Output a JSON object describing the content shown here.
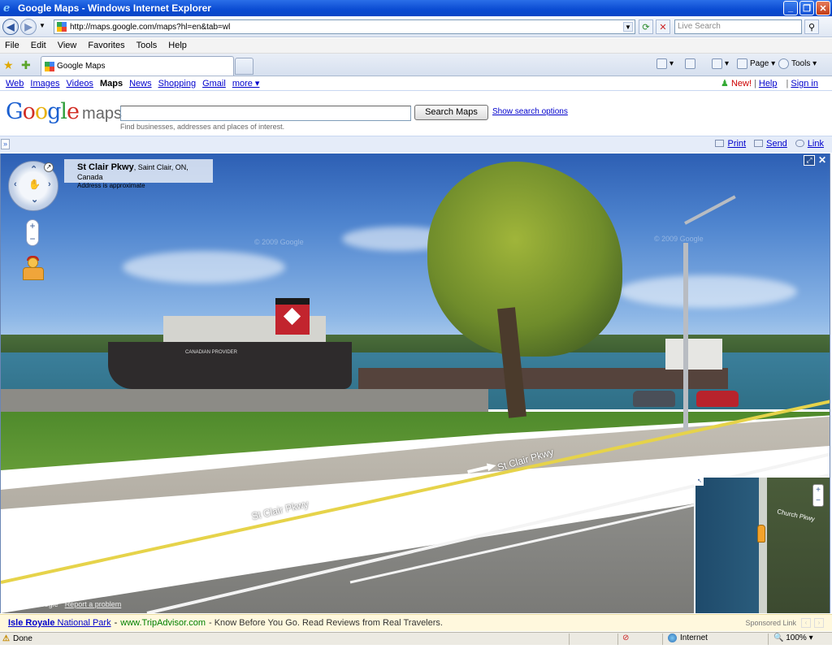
{
  "window": {
    "title": "Google Maps - Windows Internet Explorer",
    "address": "http://maps.google.com/maps?hl=en&tab=wl",
    "live_search_placeholder": "Live Search"
  },
  "menu": [
    "File",
    "Edit",
    "View",
    "Favorites",
    "Tools",
    "Help"
  ],
  "tab": {
    "label": "Google Maps"
  },
  "command_bar": {
    "page_label": "Page",
    "tools_label": "Tools"
  },
  "gbar": {
    "links": [
      "Web",
      "Images",
      "Videos",
      "Maps",
      "News",
      "Shopping",
      "Gmail",
      "more ▾"
    ],
    "active": "Maps",
    "new_label": "New!",
    "help_label": "Help",
    "signin_label": "Sign in"
  },
  "header": {
    "logo_google": "Google",
    "logo_maps": "maps",
    "search_button": "Search Maps",
    "search_options": "Show search options",
    "search_hint": "Find businesses, addresses and places of interest."
  },
  "mapbar": {
    "print": "Print",
    "send": "Send",
    "link": "Link"
  },
  "streetview": {
    "street": "St Clair Pkwy",
    "city": "Saint Clair, ON, Canada",
    "approx": "Address is approximate",
    "road_label": "St Clair Pkwy",
    "watermark": "© 2009 Google",
    "copyright": "© 2009 Google",
    "report": "Report a problem",
    "ship_name": "CANADIAN PROVIDER",
    "minimap_street": "Church Pkwy"
  },
  "ad": {
    "title_bold": "Isle Royale",
    "title_rest": "National Park",
    "url": "www.TripAdvisor.com",
    "text": "- Know Before You Go. Read Reviews from Real Travelers.",
    "sponsored": "Sponsored Link"
  },
  "status": {
    "text": "Done",
    "zone": "Internet",
    "zoom": "100%"
  }
}
